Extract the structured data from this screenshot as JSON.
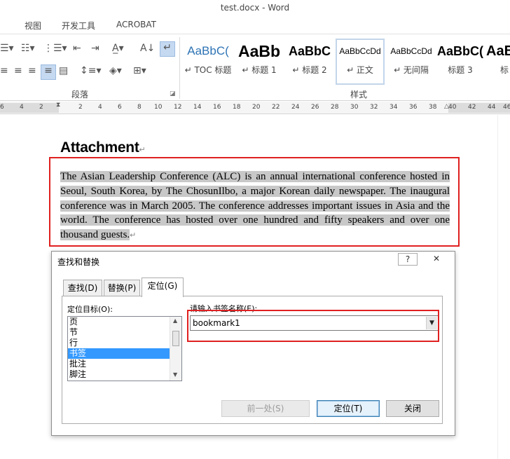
{
  "window": {
    "title": "test.docx - Word"
  },
  "ribbon_tabs": [
    "视图",
    "开发工具",
    "ACROBAT"
  ],
  "ribbon": {
    "group_paragraph": "段落",
    "group_styles": "样式",
    "styles": [
      {
        "preview": "AaBbC(",
        "label": "↵ TOC 标题"
      },
      {
        "preview": "AaBb",
        "label": "↵ 标题 1"
      },
      {
        "preview": "AaBbC",
        "label": "↵ 标题 2"
      },
      {
        "preview": "AaBbCcDd",
        "label": "↵ 正文"
      },
      {
        "preview": "AaBbCcDd",
        "label": "↵ 无间隔"
      },
      {
        "preview": "AaBbC(",
        "label": "标题 3"
      },
      {
        "preview": "AaBb",
        "label": "标"
      }
    ]
  },
  "ruler": {
    "numbers": [
      "6",
      "4",
      "2",
      "2",
      "4",
      "6",
      "8",
      "10",
      "12",
      "14",
      "16",
      "18",
      "20",
      "22",
      "24",
      "26",
      "28",
      "30",
      "32",
      "34",
      "36",
      "38",
      "40",
      "42",
      "44",
      "46"
    ]
  },
  "document": {
    "heading": "Attachment",
    "paragraph_mark": "↵",
    "paragraph": "The Asian Leadership Conference (ALC) is an annual international conference hosted in Seoul, South Korea, by The ChosunIlbo, a major Korean daily newspaper. The inaugural conference was in March 2005. The conference addresses important issues in Asia and the world. The conference has hosted over one hundred and fifty speakers and over one thousand guests."
  },
  "dialog": {
    "title": "查找和替换",
    "help": "?",
    "close": "✕",
    "tabs": [
      "查找(D)",
      "替换(P)",
      "定位(G)"
    ],
    "goto_what_label": "定位目标(O):",
    "goto_items": [
      "页",
      "节",
      "行",
      "书签",
      "批注",
      "脚注"
    ],
    "selected_item": "书签",
    "bookmark_label": "请输入书签名称(E):",
    "bookmark_value": "bookmark1",
    "buttons": {
      "previous": "前一处(S)",
      "goto": "定位(T)",
      "close": "关闭"
    }
  }
}
